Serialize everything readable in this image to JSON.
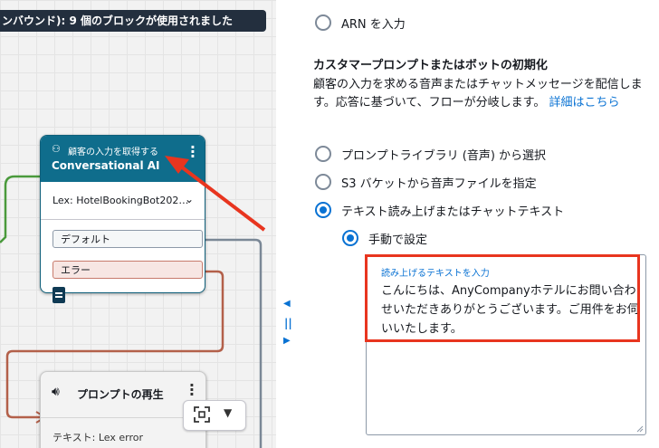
{
  "banner": {
    "text": "ンバウンド): 9 個のブロックが使用されました"
  },
  "canvas": {
    "conversational_block": {
      "type_label": "顧客の入力を取得する",
      "title": "Conversational AI",
      "lex_bot": "Lex: HotelBookingBot202…",
      "branches": [
        "デフォルト",
        "エラー"
      ]
    },
    "prompt_block": {
      "title": "プロンプトの再生",
      "text_preview": "テキスト: Lex error"
    },
    "colors": {
      "block_header": "#0f6d8c",
      "wire_green": "#4a9a3c",
      "wire_gray": "#7a8796",
      "wire_rust": "#b3604a",
      "annotation_red": "#e8351f"
    }
  },
  "panel": {
    "arn_option": "ARN を入力",
    "section_heading": "カスタマープロンプトまたはボットの初期化",
    "section_desc": "顧客の入力を求める音声またはチャットメッセージを配信します。応答に基づいて、フローが分岐します。",
    "learn_more": "詳細はこちら",
    "options": [
      {
        "label": "プロンプトライブラリ (音声) から選択",
        "checked": false
      },
      {
        "label": "S3 バケットから音声ファイルを指定",
        "checked": false
      },
      {
        "label": "テキスト読み上げまたはチャットテキスト",
        "checked": true
      }
    ],
    "sub_option": {
      "label": "手動で設定",
      "checked": true
    },
    "text_input": {
      "label": "読み上げるテキストを入力",
      "value": "こんにちは、AnyCompanyホテルにお問い合わせいただきありがとうございます。ご用件をお伺いいたします。"
    },
    "accent_color": "#0972d3"
  }
}
